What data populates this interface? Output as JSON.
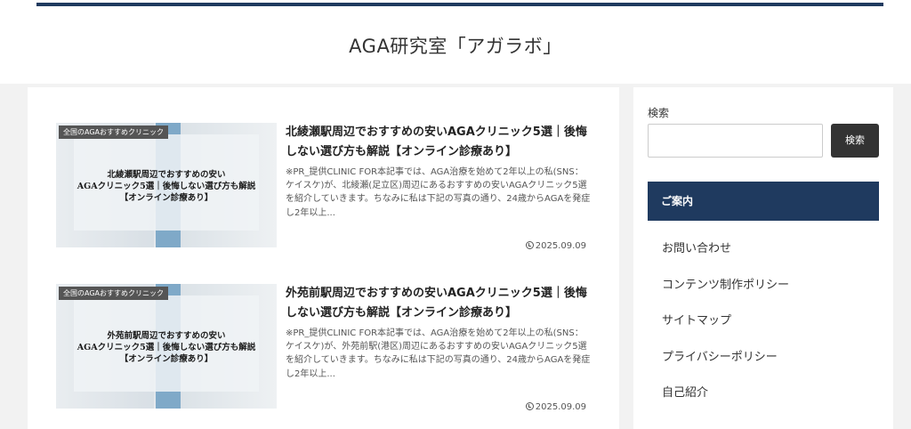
{
  "header": {
    "site_title": "AGA研究室「アガラボ」",
    "accent_color": "#1f3a5f"
  },
  "articles": [
    {
      "category": "全国のAGAおすすめクリニック",
      "thumb_lines": [
        "北綾瀬駅周辺でおすすめの安い",
        "AGAクリニック5選｜後悔しない選び方も解説",
        "【オンライン診療あり】"
      ],
      "title": "北綾瀬駅周辺でおすすめの安いAGAクリニック5選｜後悔しない選び方も解説【オンライン診療あり】",
      "excerpt": "※PR_提供CLINIC FOR本記事では、AGA治療を始めて2年以上の私(SNS：ケイスケ)が、北綾瀬(足立区)周辺にあるおすすめの安いAGAクリニック5選を紹介していきます。ちなみに私は下記の写真の通り、24歳からAGAを発症し2年以上...",
      "date": "2025.09.09"
    },
    {
      "category": "全国のAGAおすすめクリニック",
      "thumb_lines": [
        "外苑前駅周辺でおすすめの安い",
        "AGAクリニック5選｜後悔しない選び方も解説",
        "【オンライン診療あり】"
      ],
      "title": "外苑前駅周辺でおすすめの安いAGAクリニック5選｜後悔しない選び方も解説【オンライン診療あり】",
      "excerpt": "※PR_提供CLINIC FOR本記事では、AGA治療を始めて2年以上の私(SNS：ケイスケ)が、外苑前駅(港区)周辺にあるおすすめの安いAGAクリニック5選を紹介していきます。ちなみに私は下記の写真の通り、24歳からAGAを発症し2年以上...",
      "date": "2025.09.09"
    }
  ],
  "sidebar": {
    "search_label": "検索",
    "search_value": "",
    "search_button": "検索",
    "guide_heading": "ご案内",
    "menu": [
      "お問い合わせ",
      "コンテンツ制作ポリシー",
      "サイトマップ",
      "プライバシーポリシー",
      "自己紹介"
    ]
  },
  "icons": {
    "date": "clock-icon"
  }
}
